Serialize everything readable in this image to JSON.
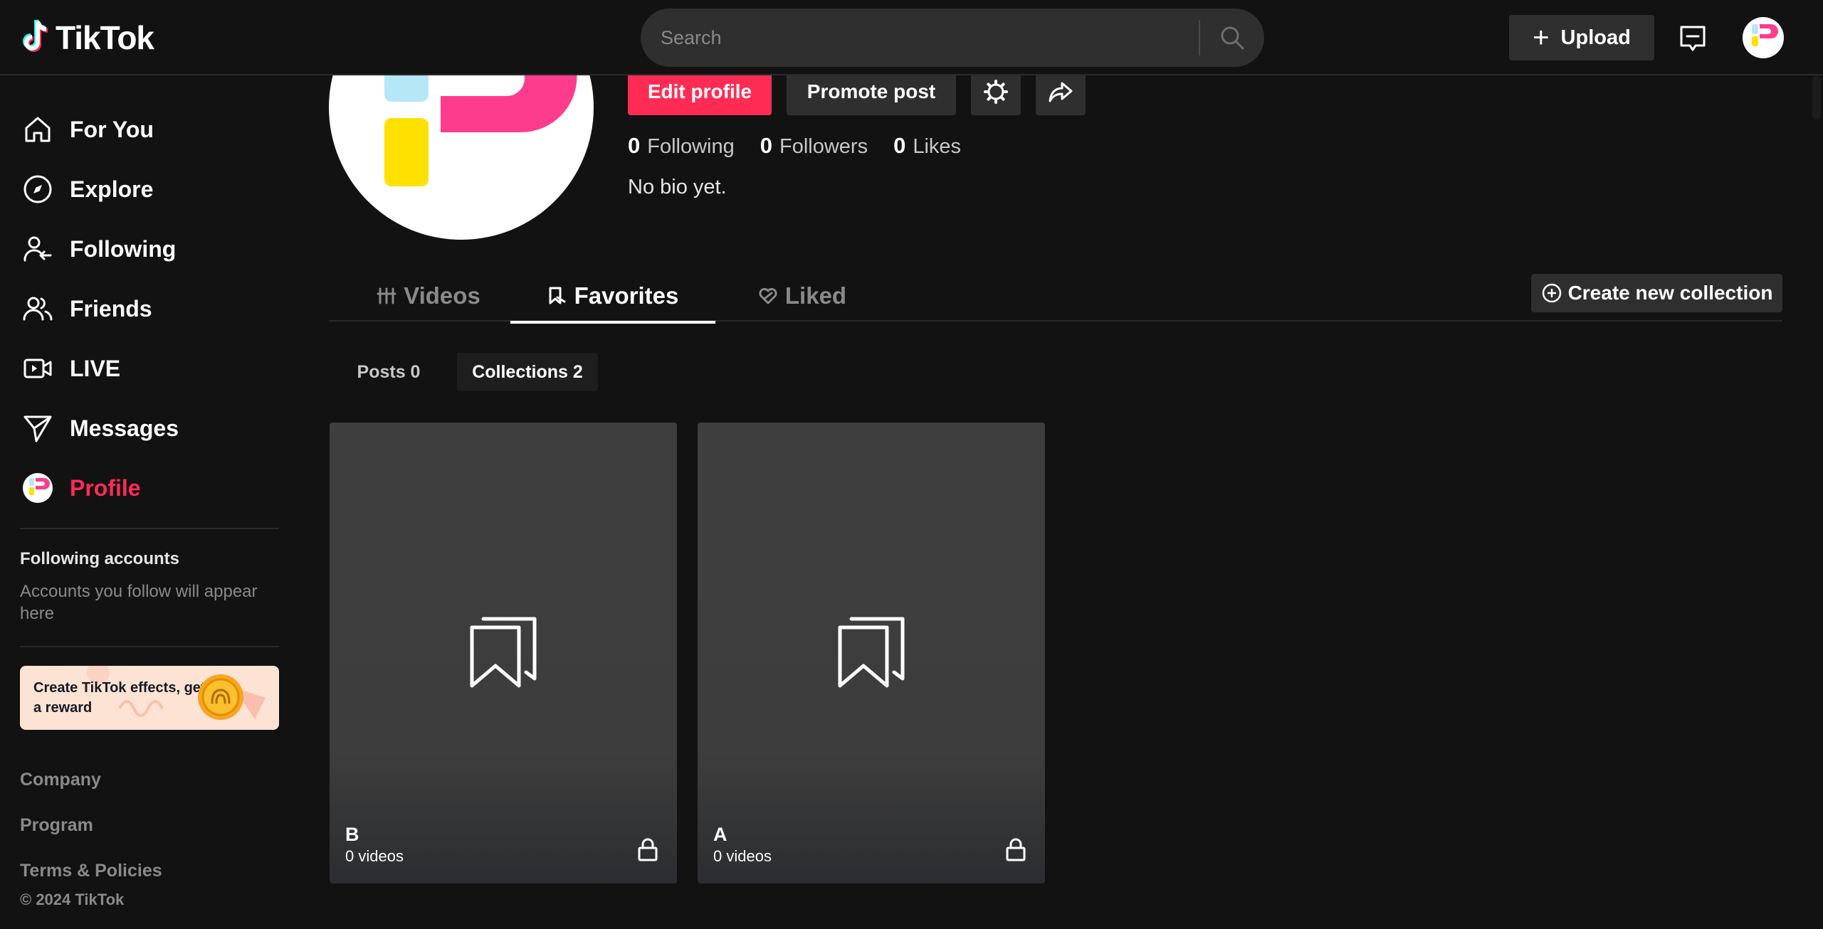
{
  "brand": {
    "name": "TikTok",
    "accent": "#fe2c55",
    "cyan": "#25f4ee"
  },
  "header": {
    "search_placeholder": "Search",
    "upload_label": "Upload",
    "upload_icon": "plus-icon",
    "inbox_icon": "inbox-icon"
  },
  "sidebar": {
    "nav": [
      {
        "label": "For You",
        "icon": "home-icon"
      },
      {
        "label": "Explore",
        "icon": "compass-icon"
      },
      {
        "label": "Following",
        "icon": "user-follow-icon"
      },
      {
        "label": "Friends",
        "icon": "friends-icon"
      },
      {
        "label": "LIVE",
        "icon": "live-icon"
      },
      {
        "label": "Messages",
        "icon": "paper-plane-icon"
      },
      {
        "label": "Profile",
        "icon": "avatar",
        "active": true
      }
    ],
    "following_title": "Following accounts",
    "following_sub": "Accounts you follow will appear here",
    "effects_banner": "Create TikTok effects, get a reward",
    "footer_links": [
      "Company",
      "Program",
      "Terms & Policies"
    ],
    "copyright": "© 2024 TikTok"
  },
  "profile": {
    "edit_label": "Edit profile",
    "promote_label": "Promote post",
    "settings_icon": "gear-icon",
    "share_icon": "share-icon",
    "stats": [
      {
        "num": "0",
        "label": "Following"
      },
      {
        "num": "0",
        "label": "Followers"
      },
      {
        "num": "0",
        "label": "Likes"
      }
    ],
    "bio": "No bio yet."
  },
  "tabs": [
    {
      "label": "Videos",
      "icon": "grid-icon"
    },
    {
      "label": "Favorites",
      "icon": "bookmark-icon",
      "active": true
    },
    {
      "label": "Liked",
      "icon": "heart-icon"
    }
  ],
  "create_collection_label": "Create new collection",
  "subtabs": [
    {
      "label": "Posts 0"
    },
    {
      "label": "Collections 2",
      "active": true
    }
  ],
  "collections": [
    {
      "name": "B",
      "count": "0 videos",
      "private": true
    },
    {
      "name": "A",
      "count": "0 videos",
      "private": true
    }
  ]
}
